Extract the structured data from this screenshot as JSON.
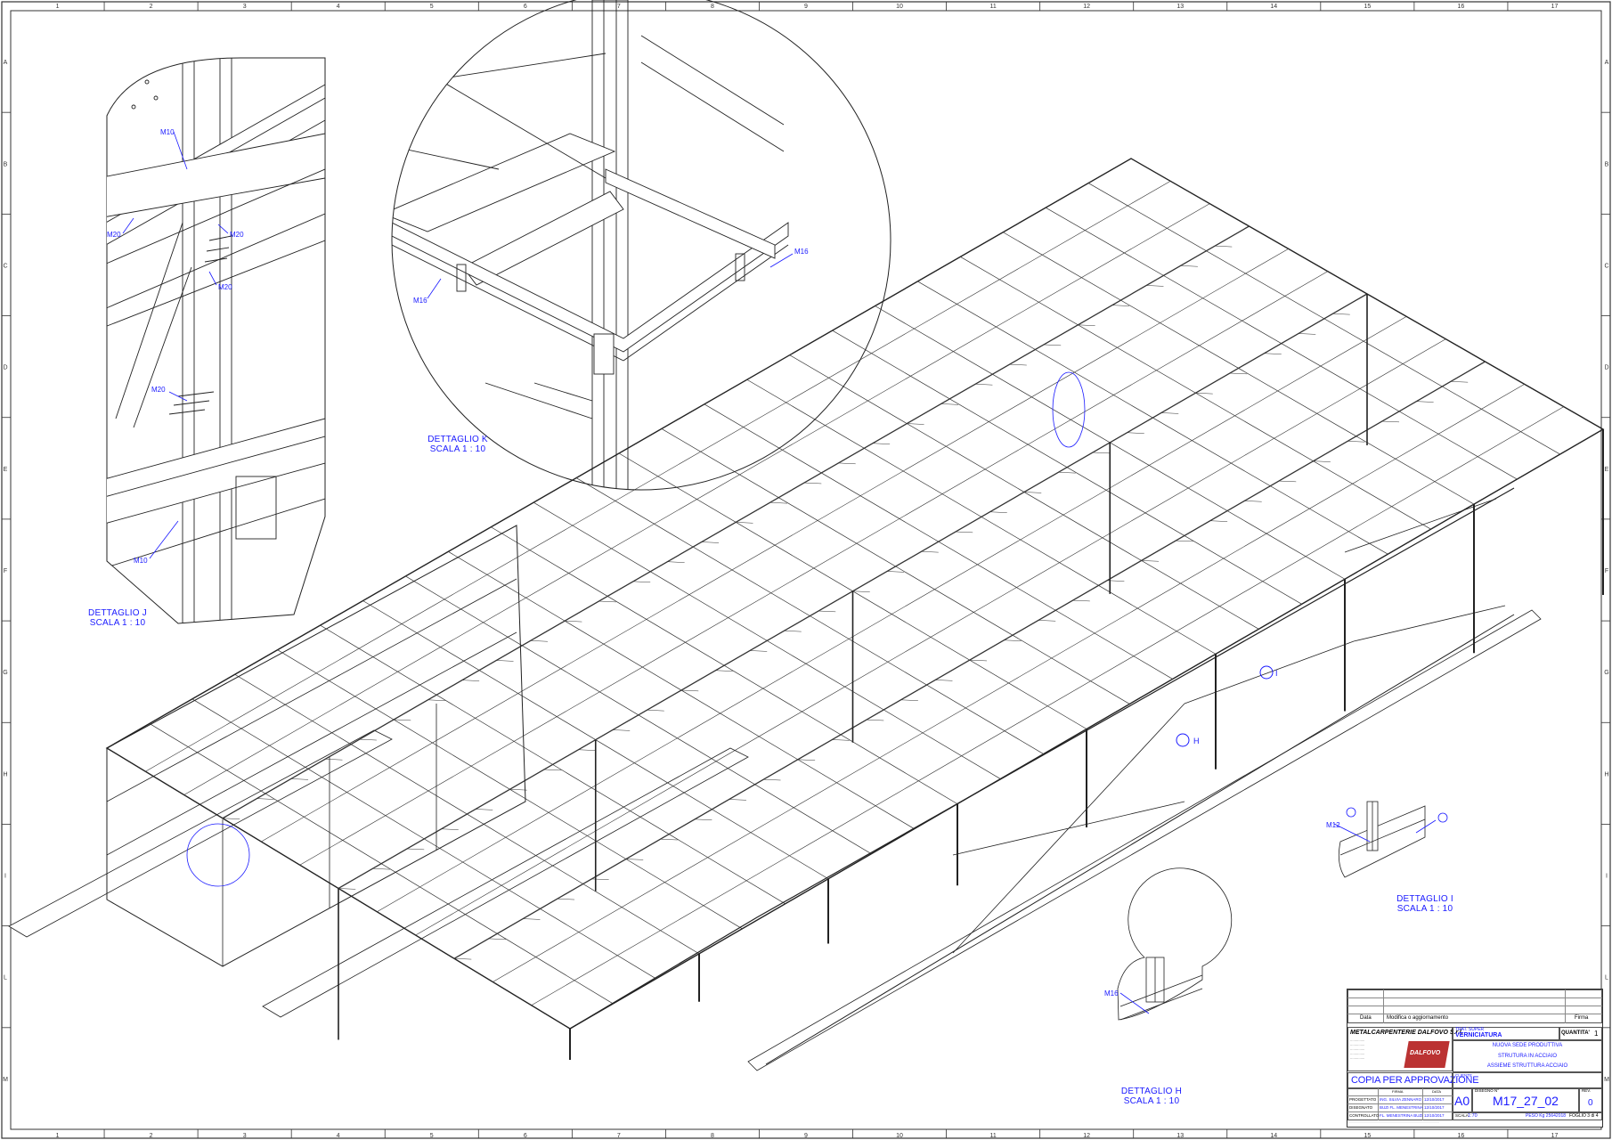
{
  "sheet": {
    "columns": [
      "1",
      "2",
      "3",
      "4",
      "5",
      "6",
      "7",
      "8",
      "9",
      "10",
      "11",
      "12",
      "13",
      "14",
      "15",
      "16",
      "17"
    ],
    "rows": [
      "A",
      "B",
      "C",
      "D",
      "E",
      "F",
      "G",
      "H",
      "I",
      "L",
      "M"
    ],
    "colors": {
      "line": "#222222",
      "annotation": "#1a1aff",
      "logo": "#cc2222"
    }
  },
  "details": {
    "j": {
      "label_line1": "DETTAGLIO J",
      "label_line2": "SCALA 1 : 10",
      "callouts": [
        "M10",
        "M20",
        "M20",
        "M20",
        "M20",
        "M10"
      ]
    },
    "k": {
      "label_line1": "DETTAGLIO K",
      "label_line2": "SCALA 1 : 10",
      "callouts": [
        "M16",
        "M16"
      ]
    },
    "i": {
      "label_line1": "DETTAGLIO I",
      "label_line2": "SCALA 1 : 10",
      "callouts": [
        "M12"
      ]
    },
    "h": {
      "label_line1": "DETTAGLIO H",
      "label_line2": "SCALA 1 : 10",
      "callouts": [
        "M16"
      ]
    },
    "markers": {
      "h": "H",
      "i": "I"
    }
  },
  "title_block": {
    "rev_header": {
      "rev": "Data",
      "desc": "Modifica o aggiornamento",
      "sign": "Firma"
    },
    "company": "METALCARPENTERIE DALFOVO S.r.l.",
    "customer_label": "TRAT. SUPER",
    "project": "VERNICIATURA",
    "quantity_label": "QUANTITA'",
    "quantity": "1",
    "description_1": "NUOVA SEDE PRODUTTIVA",
    "description_2": "STRUTURA IN ACCIAIO",
    "description_3": "ASSIEME STRUTTURA ACCIAIO",
    "client_label": "CLIENTE",
    "stamp": "COPIA PER APPROVAZIONE",
    "roles": [
      {
        "role": "PROGETTATO",
        "name": "ING. SILVIA ZENNARO",
        "date": "12/10/2017"
      },
      {
        "role": "DISEGNATO",
        "name": "BUZI FL. MENESTRINA",
        "date": "12/10/2017"
      },
      {
        "role": "CONTROLLATO",
        "name": "FL. MENESTRINA BUZI",
        "date": "12/10/2017"
      }
    ],
    "col_firma": "FIRMA",
    "col_data": "DATA",
    "format": "A0",
    "drawing_label": "DISEGNO N°",
    "drawing_number": "M17_27_02",
    "rev_label": "REV.",
    "revision": "0",
    "scale_label": "SCALA",
    "scale": "1:70",
    "weight": "PESO Kg 25642018",
    "sheet_no": "FOGLIO 3 di 4",
    "logo_text": "DALFOVO"
  }
}
